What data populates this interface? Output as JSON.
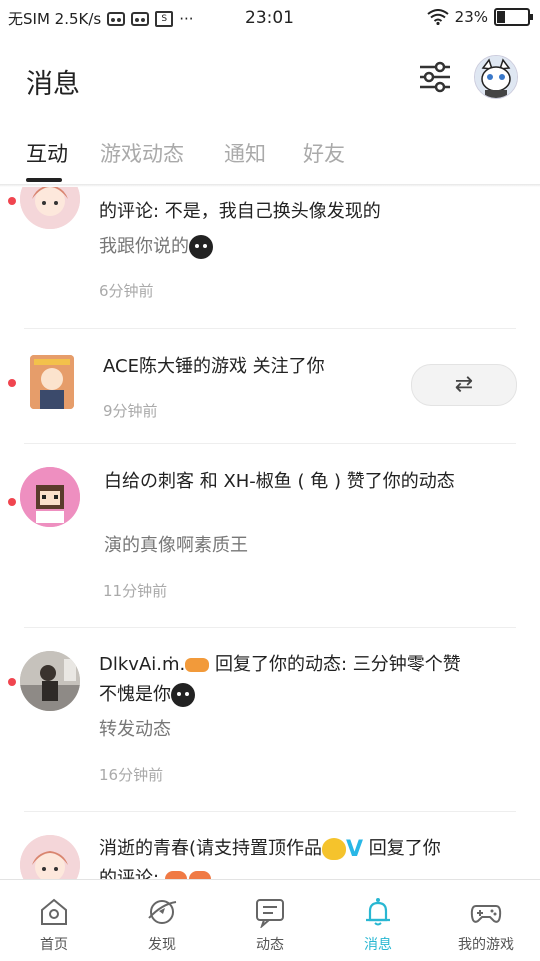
{
  "status_bar": {
    "carrier": "无SIM 2.5K/s",
    "dots": "···",
    "time": "23:01",
    "battery": "23%",
    "s_icon_text": "S"
  },
  "header": {
    "title": "消息"
  },
  "tabs": [
    {
      "label": "互动",
      "active": true
    },
    {
      "label": "游戏动态",
      "active": false
    },
    {
      "label": "通知",
      "active": false
    },
    {
      "label": "好友",
      "active": false
    }
  ],
  "feed": [
    {
      "line2": "的评论: 不是，我自己换头像发现的",
      "sub": "我跟你说的",
      "time": "6分钟前"
    },
    {
      "line1": "ACE陈大锤的游戏 关注了你",
      "time": "9分钟前",
      "follow_icon": "⇄"
    },
    {
      "line1": "白给の刺客 和 XH-椒鱼 ( 龟 ) 赞了你的动态",
      "sub": "演的真像啊素质王",
      "time": "11分钟前"
    },
    {
      "line1_name": "DlkvAi.ṁ.",
      "line1_rest": " 回复了你的动态: 三分钟零个赞",
      "line2": "不愧是你",
      "sub": "转发动态",
      "time": "16分钟前"
    },
    {
      "line1": "消逝的青春(请支持置顶作品",
      "line1_after": " 回复了你",
      "line2": "的评论:"
    }
  ],
  "bottom_nav": [
    {
      "label": "首页",
      "icon": "home-icon"
    },
    {
      "label": "发现",
      "icon": "discover-icon"
    },
    {
      "label": "动态",
      "icon": "feed-icon"
    },
    {
      "label": "消息",
      "icon": "bell-icon",
      "active": true
    },
    {
      "label": "我的游戏",
      "icon": "gamepad-icon"
    }
  ],
  "colors": {
    "accent": "#29b7d2",
    "unread_dot": "#f0454f"
  }
}
